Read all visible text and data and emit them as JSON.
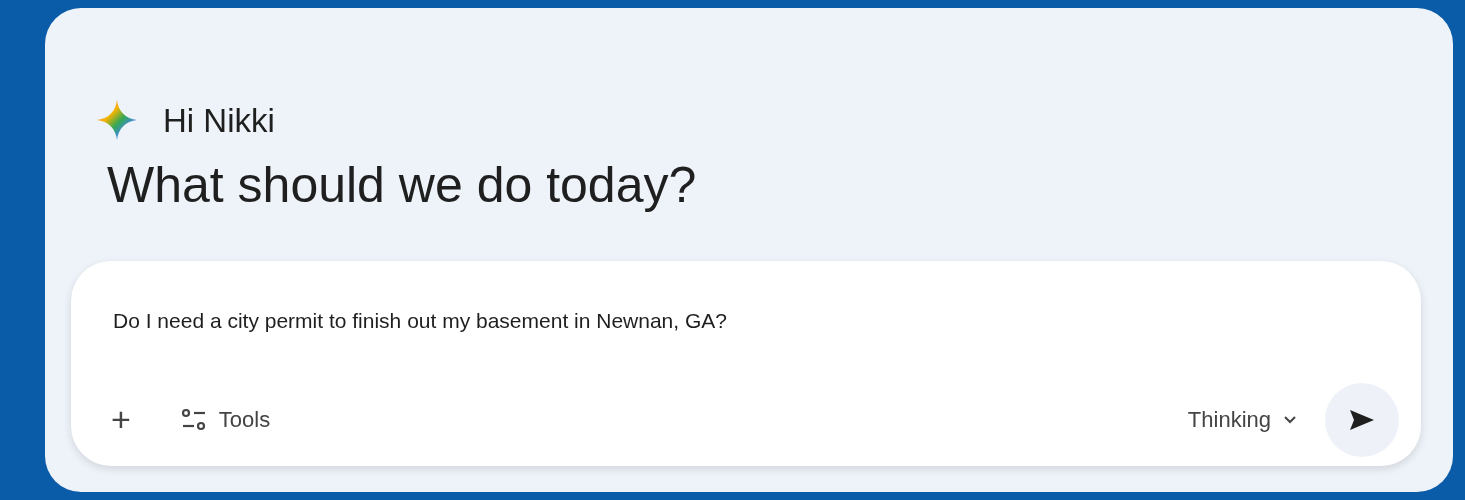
{
  "greeting": "Hi Nikki",
  "heading": "What should we do today?",
  "prompt": {
    "value": "Do I need a city permit to finish out my basement in Newnan, GA?"
  },
  "toolbar": {
    "add": "+",
    "tools": "Tools",
    "model": "Thinking"
  }
}
